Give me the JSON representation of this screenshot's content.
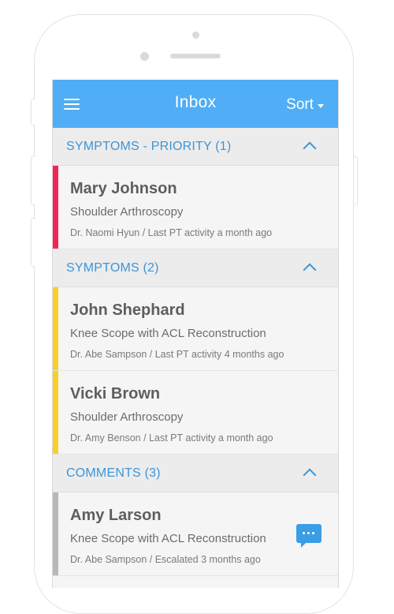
{
  "header": {
    "title": "Inbox",
    "sort_label": "Sort"
  },
  "colors": {
    "accent": "#4faef5",
    "section_text": "#3d95d8",
    "priority_bar": "#f0265a",
    "symptom_bar": "#f7cf2c",
    "comment_bar": "#b8b8b8"
  },
  "sections": [
    {
      "title": "SYMPTOMS - PRIORITY (1)",
      "items": [
        {
          "name": "Mary Johnson",
          "procedure": "Shoulder Arthroscopy",
          "meta": "Dr. Naomi Hyun / Last PT activity a month ago"
        }
      ]
    },
    {
      "title": "SYMPTOMS (2)",
      "items": [
        {
          "name": "John Shephard",
          "procedure": "Knee Scope with ACL Reconstruction",
          "meta": "Dr. Abe Sampson / Last PT activity 4 months ago"
        },
        {
          "name": "Vicki Brown",
          "procedure": "Shoulder Arthroscopy",
          "meta": "Dr. Amy Benson / Last PT activity a month ago"
        }
      ]
    },
    {
      "title": "COMMENTS (3)",
      "items": [
        {
          "name": "Amy Larson",
          "procedure": "Knee Scope with ACL Reconstruction",
          "meta": "Dr. Abe Sampson / Escalated 3 months ago",
          "icon": "chat-bubble-icon"
        }
      ]
    }
  ]
}
